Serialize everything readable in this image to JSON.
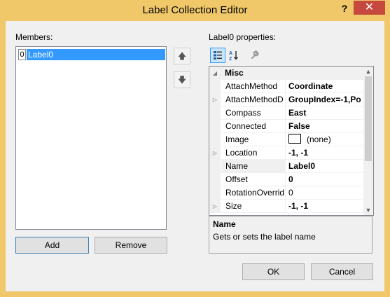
{
  "window": {
    "title": "Label Collection Editor",
    "help_glyph": "?",
    "close_glyph": "✕"
  },
  "members": {
    "label": "Members:",
    "items": [
      {
        "index": "0",
        "label": "Label0",
        "selected": true
      }
    ],
    "move_up_glyph": "🡅",
    "move_down_glyph": "🡇",
    "add_label": "Add",
    "remove_label": "Remove"
  },
  "properties": {
    "label": "Label0 properties:",
    "toolbar": {
      "categorized_icon": "categorized-icon",
      "alphabetical_icon": "alphabetical-icon",
      "property_pages_icon": "wrench-icon"
    },
    "category": "Misc",
    "rows": [
      {
        "name": "AttachMethod",
        "value": "Coordinate",
        "bold": true,
        "expandable": false
      },
      {
        "name": "AttachMethodD",
        "value": "GroupIndex=-1,Po",
        "bold": true,
        "expandable": true
      },
      {
        "name": "Compass",
        "value": "East",
        "bold": true,
        "expandable": false
      },
      {
        "name": "Connected",
        "value": "False",
        "bold": true,
        "expandable": false
      },
      {
        "name": "Image",
        "value": "(none)",
        "bold": false,
        "expandable": false
      },
      {
        "name": "Location",
        "value": "-1, -1",
        "bold": true,
        "expandable": true
      },
      {
        "name": "Name",
        "value": "Label0",
        "bold": true,
        "expandable": false
      },
      {
        "name": "Offset",
        "value": "0",
        "bold": true,
        "expandable": false
      },
      {
        "name": "RotationOverrid",
        "value": "0",
        "bold": false,
        "expandable": false
      },
      {
        "name": "Size",
        "value": "-1, -1",
        "bold": true,
        "expandable": true
      }
    ],
    "help_title": "Name",
    "help_desc": "Gets or sets the label name"
  },
  "buttons": {
    "ok": "OK",
    "cancel": "Cancel"
  },
  "colors": {
    "titlebar": "#f0c86a",
    "close": "#c7483e",
    "selection": "#3399ff",
    "client": "#f0f0f0"
  }
}
